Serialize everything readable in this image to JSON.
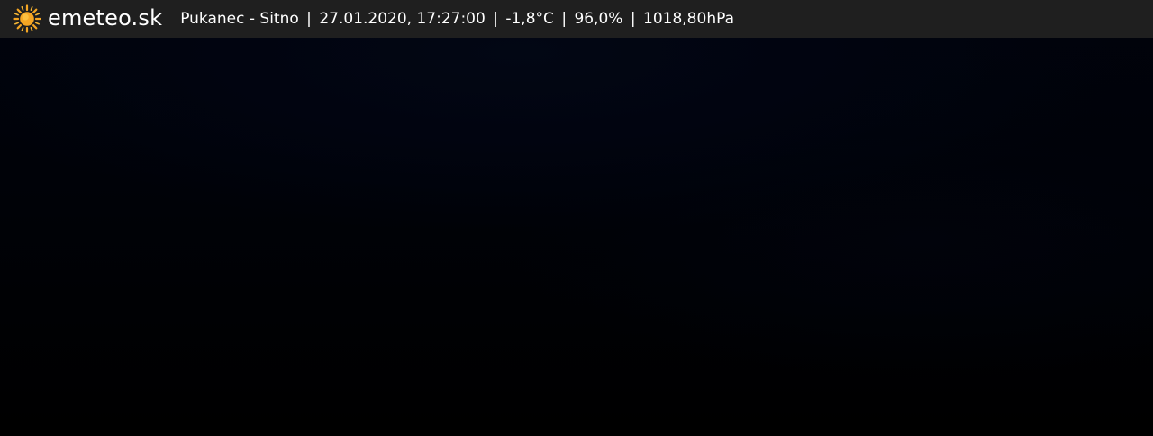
{
  "overlay": {
    "brand": "emeteo.sk",
    "logo_icon": "sun-icon",
    "accent_color": "#f5a623",
    "bar_color": "#1f1f1f",
    "location": "Pukanec - Sitno",
    "datetime": "27.01.2020, 17:27:00",
    "temperature": "-1,8°C",
    "humidity": "96,0%",
    "pressure": "1018,80hPa",
    "separator": "|"
  }
}
